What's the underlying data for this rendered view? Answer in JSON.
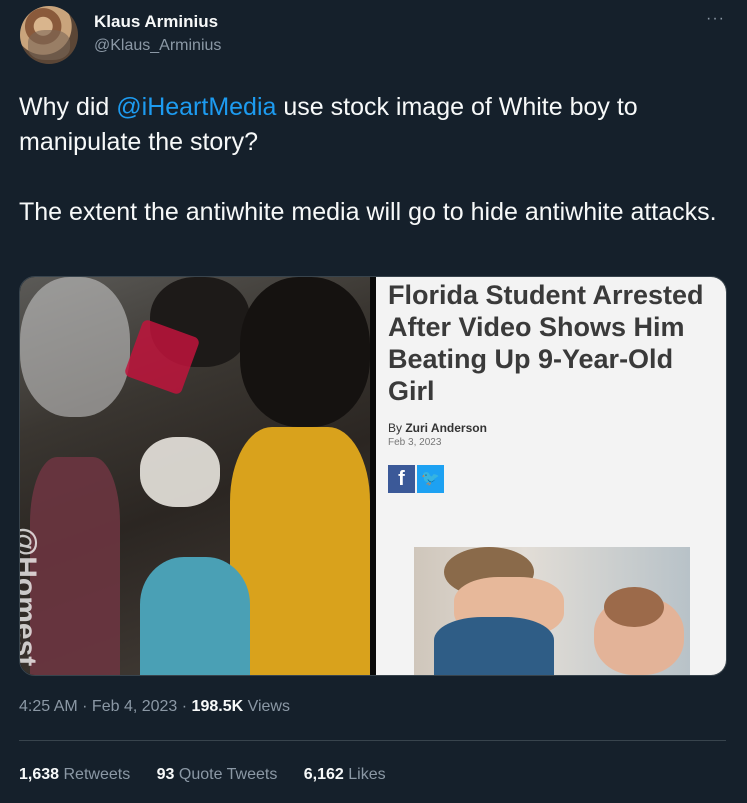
{
  "author": {
    "display_name": "Klaus Arminius",
    "handle": "@Klaus_Arminius"
  },
  "menu": {
    "more_label": "···"
  },
  "tweet": {
    "text_1": "Why did ",
    "mention": "@iHeartMedia",
    "text_2": " use stock image of White boy to manipulate the story?\n\nThe extent the antiwhite media will go to hide antiwhite attacks."
  },
  "media": {
    "watermark": "@Homest",
    "article": {
      "headline": "Florida Student Arrested After Video Shows Him Beating Up 9-Year-Old Girl",
      "byline_prefix": "By ",
      "byline_author": "Zuri Anderson",
      "date": "Feb 3, 2023",
      "share_facebook": "f",
      "share_twitter": "🐦"
    }
  },
  "meta": {
    "time": "4:25 AM",
    "dot": " · ",
    "date": "Feb 4, 2023",
    "dot2": " · ",
    "views_count": "198.5K",
    "views_label": " Views"
  },
  "stats": {
    "retweets_count": "1,638",
    "retweets_label": " Retweets",
    "quotes_count": "93",
    "quotes_label": " Quote Tweets",
    "likes_count": "6,162",
    "likes_label": " Likes"
  },
  "colors": {
    "background": "#15202b",
    "link": "#1d9bf0",
    "secondary_text": "#8b98a5"
  }
}
